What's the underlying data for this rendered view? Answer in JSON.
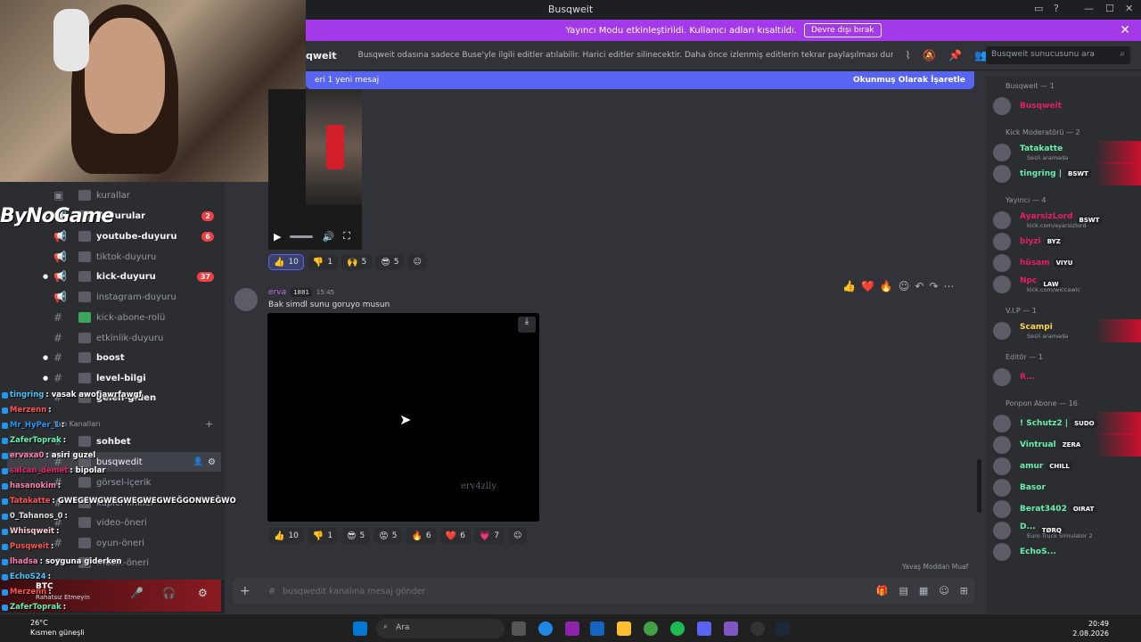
{
  "window": {
    "title": "Busqweit",
    "minimize": "—",
    "maximize": "☐",
    "close": "✕"
  },
  "banner": {
    "text": "Yayıncı Modu etkinleştirildi. Kullanıcı adları kısaltıldı.",
    "button": "Devre dışı bırak",
    "close": "✕"
  },
  "header": {
    "channel": "qweit",
    "topic": "Busqweit odasına sadece Buse'yle ilgili editler atılabilir. Harici editler silinecektir. Daha önce izlenmiş editlerin tekrar paylaşılması durumunda edit sili...",
    "search_placeholder": "Busqweit sunucusunu ara"
  },
  "newbar": {
    "text": "eri 1 yeni mesaj",
    "action": "Okunmuş Olarak İşaretle"
  },
  "overlay_logo": "ByNoGame",
  "sidebar": {
    "channels": [
      {
        "label": "kurallar"
      },
      {
        "label": "duyurular",
        "badge": "2"
      },
      {
        "label": "youtube-duyuru",
        "badge": "6"
      },
      {
        "label": "tiktok-duyuru"
      },
      {
        "label": "kick-duyuru",
        "badge": "37"
      },
      {
        "label": "instagram-duyuru"
      },
      {
        "label": "kick-abone-rolü"
      },
      {
        "label": "etkinlik-duyuru"
      },
      {
        "label": "boost"
      },
      {
        "label": "level-bilgi"
      },
      {
        "label": "gelen-giden"
      },
      {
        "label": "sohbet"
      },
      {
        "label": "busqwedit"
      },
      {
        "label": "görsel-içerik"
      },
      {
        "label": "kupler-linkler"
      },
      {
        "label": "video-öneri"
      },
      {
        "label": "oyun-öneri"
      },
      {
        "label": "müzik-öneri"
      }
    ],
    "category": "Yazı Kanalları",
    "user": {
      "name": "BTC",
      "status": "Rahatsız Etmeyin"
    }
  },
  "overlay_chat": [
    {
      "user": "tingring",
      "msg": ": vasak awofjawrfawgf",
      "color": "#4fc3f7"
    },
    {
      "user": "Merzenn",
      "msg": ":",
      "color": "#ff5252"
    },
    {
      "user": "Mr_HyPer_1",
      "msg": ":",
      "color": "#2196f3"
    },
    {
      "user": "ZaferToprak",
      "msg": ":",
      "color": "#69f0ae"
    },
    {
      "user": "ervaxa0",
      "msg": ": asiri guzel",
      "color": "#ff80ab"
    },
    {
      "user": "salcan_demet",
      "msg": ": bipolar",
      "color": "#e91e63"
    },
    {
      "user": "hasanokim",
      "msg": ":",
      "color": "#ff80ab"
    },
    {
      "user": "Tatakatte",
      "msg": ": GWEGEWGWEGWEGWEGWEĞGONWEĞWO",
      "color": "#ff5252"
    },
    {
      "user": "0_Tahanos_0",
      "msg": ":",
      "color": "#e0e0e0"
    },
    {
      "user": "Whisqweit",
      "msg": ":",
      "color": "#ffcdd2"
    },
    {
      "user": "Pusqweit",
      "msg": ":",
      "color": "#ff5252"
    },
    {
      "user": "lhadsa",
      "msg": ": soyguna giderken",
      "color": "#ff80ab"
    },
    {
      "user": "EchoS24",
      "msg": ":",
      "color": "#4fc3f7"
    },
    {
      "user": "Merzenn",
      "msg": ":",
      "color": "#ff5252"
    },
    {
      "user": "ZaferToprak",
      "msg": ":",
      "color": "#69f0ae"
    }
  ],
  "messages": {
    "first": {
      "reactions": [
        {
          "e": "👍",
          "n": "10"
        },
        {
          "e": "👎",
          "n": "1"
        },
        {
          "e": "🙌",
          "n": "5"
        },
        {
          "e": "😎",
          "n": "5"
        }
      ]
    },
    "second": {
      "author": "erva",
      "level": "1881",
      "time": "15:45",
      "text": "Bak simdl sunu goruyo musun",
      "watermark": "erv4zlly",
      "reactions": [
        {
          "e": "👍",
          "n": "10"
        },
        {
          "e": "👎",
          "n": "1"
        },
        {
          "e": "😎",
          "n": "5"
        },
        {
          "e": "😡",
          "n": "5"
        },
        {
          "e": "🔥",
          "n": "6"
        },
        {
          "e": "❤️",
          "n": "6"
        },
        {
          "e": "💗",
          "n": "7"
        }
      ]
    }
  },
  "slowmode": "Yavaş Moddan Muaf",
  "input_placeholder": "busqwedit kanalına mesaj gönder",
  "members": {
    "groups": [
      {
        "name": "Busqweit — 1",
        "members": [
          {
            "name": "Busqweit",
            "color": "#e91e63"
          }
        ]
      },
      {
        "name": "Kick Moderatörü — 2",
        "members": [
          {
            "name": "Tatakatte",
            "color": "#69f0ae",
            "sub": "Sesli aramada"
          },
          {
            "name": "tingring |",
            "color": "#69f0ae",
            "tag": "BSWT"
          }
        ]
      },
      {
        "name": "Yayıncı — 4",
        "members": [
          {
            "name": "AyarsizLord",
            "color": "#e91e63",
            "tag": "BSWT",
            "sub": "kick.com/ayarsizlord"
          },
          {
            "name": "biyzi",
            "color": "#e91e63",
            "tag": "BYZ"
          },
          {
            "name": "hüsam",
            "color": "#e91e63",
            "tag": "VIYU"
          },
          {
            "name": "Npc",
            "color": "#e91e63",
            "tag": "LAW",
            "sub": "kick.com/wiccawic"
          }
        ]
      },
      {
        "name": "V.I.P — 1",
        "members": [
          {
            "name": "Scampi",
            "color": "#ffd54f",
            "sub": "Sesli aramada"
          }
        ]
      },
      {
        "name": "Editör — 1",
        "members": [
          {
            "name": "R...",
            "color": "#e91e63"
          }
        ]
      },
      {
        "name": "Ponpon Abone — 16",
        "members": [
          {
            "name": "! Schutz2 |",
            "color": "#69f0ae",
            "tag": "SUDO"
          },
          {
            "name": "Vintrual",
            "color": "#69f0ae",
            "tag": "ZERA"
          },
          {
            "name": "amur",
            "color": "#69f0ae",
            "tag": "CHILL"
          },
          {
            "name": "Basor",
            "color": "#69f0ae"
          },
          {
            "name": "Berat3402",
            "color": "#69f0ae",
            "tag": "OIRAT"
          },
          {
            "name": "D...",
            "color": "#69f0ae",
            "tag": "TØRQ",
            "sub": "Euro Truck Simulator 2"
          },
          {
            "name": "EchoS...",
            "color": "#69f0ae"
          }
        ]
      }
    ]
  },
  "taskbar": {
    "temp": "26°C",
    "weather": "Kısmen güneşli",
    "search": "Ara",
    "time": "20:49",
    "date": "2.08.2026"
  }
}
